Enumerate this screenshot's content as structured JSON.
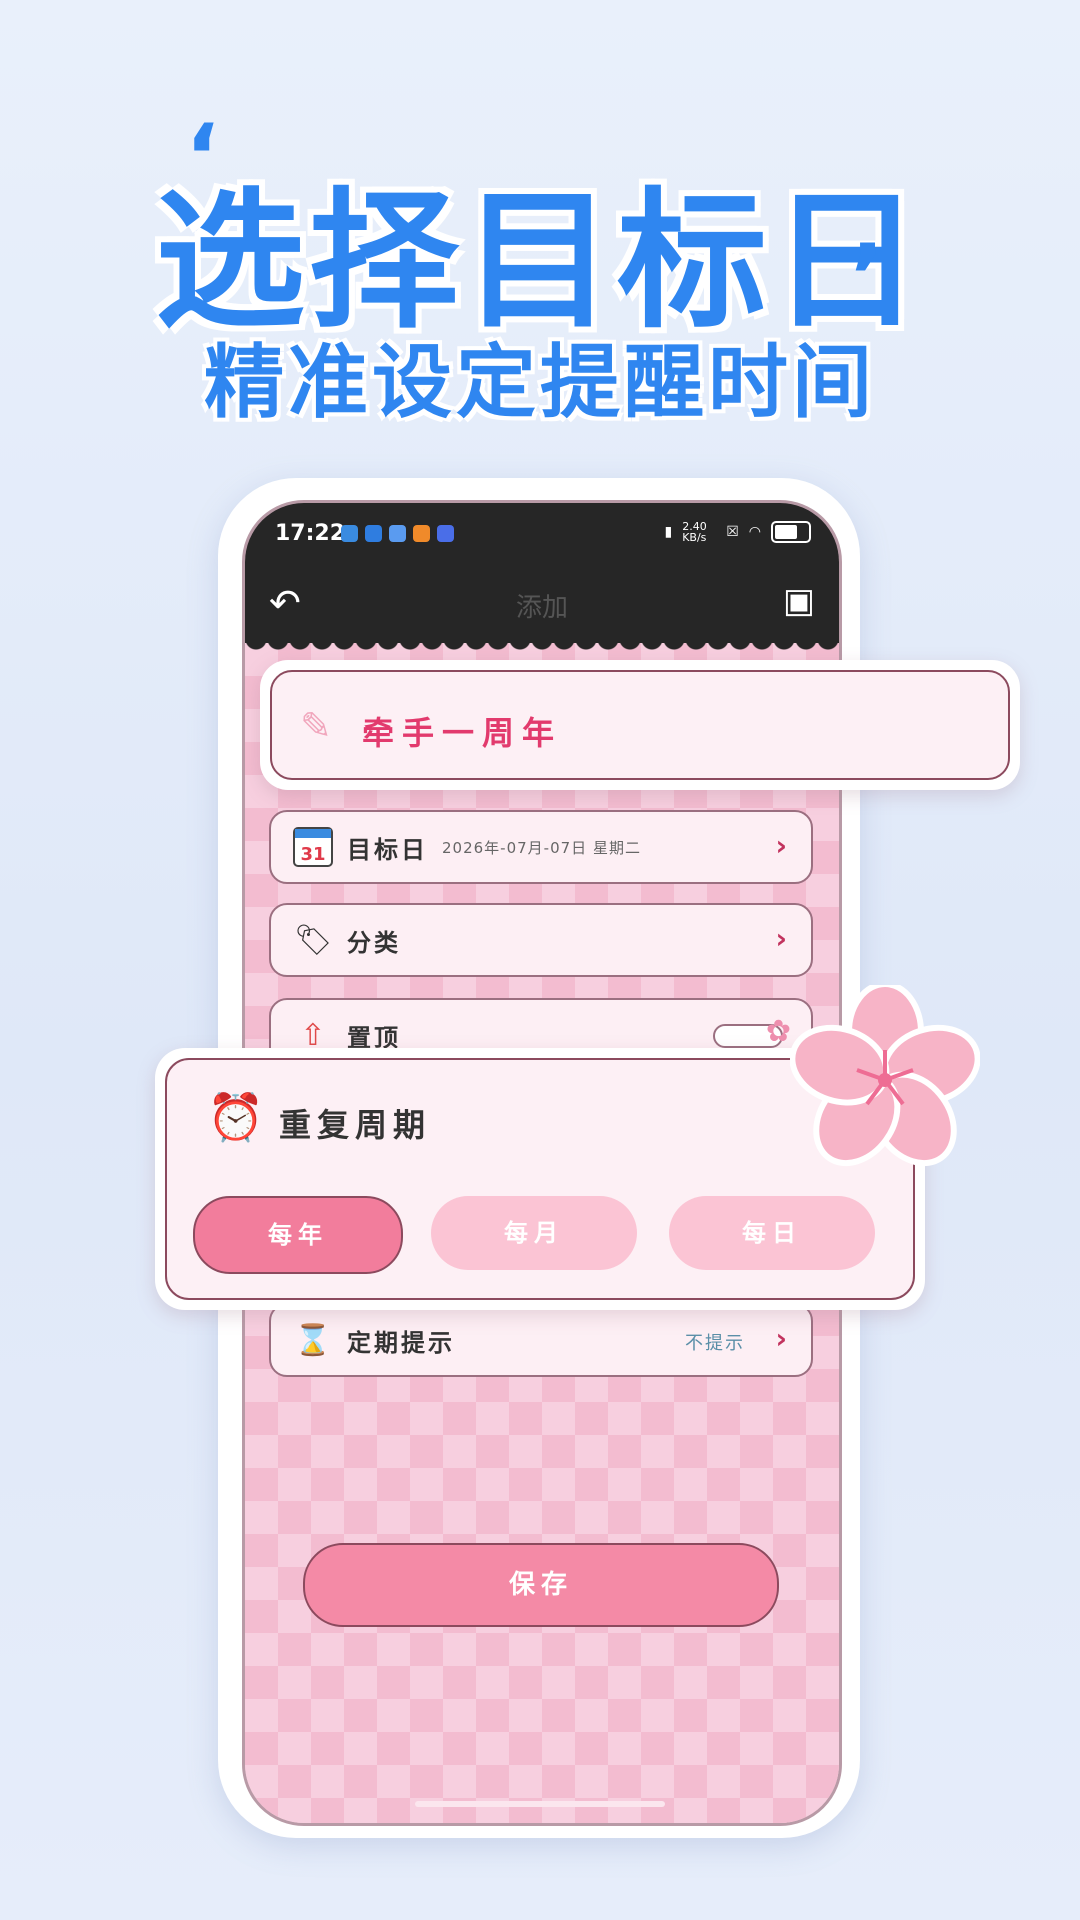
{
  "headline": "选择目标日",
  "subheadline": "精准设定提醒时间",
  "status_bar": {
    "time": "17:22",
    "net_speed": "2.40 KB/s"
  },
  "app_bar": {
    "title": "添加"
  },
  "event_name": "牵手一周年",
  "rows": {
    "target_date": {
      "label": "目标日",
      "value": "2026年-07月-07日 星期二",
      "icon": "calendar-icon",
      "icon_text": "31"
    },
    "category": {
      "label": "分类",
      "icon": "tag-icon"
    },
    "pin": {
      "label": "置顶",
      "icon": "pin-top-icon"
    },
    "reminder": {
      "label": "定期提示",
      "value": "不提示",
      "icon": "hourglass-icon"
    }
  },
  "repeat": {
    "label": "重复周期",
    "options": [
      "每年",
      "每月",
      "每日"
    ],
    "selected": "每年"
  },
  "save_button": "保存",
  "colors": {
    "accent_blue": "#2f86f0",
    "pink_primary": "#f27d9c",
    "pink_light": "#fbc4d4",
    "title_red": "#e23a6d"
  }
}
